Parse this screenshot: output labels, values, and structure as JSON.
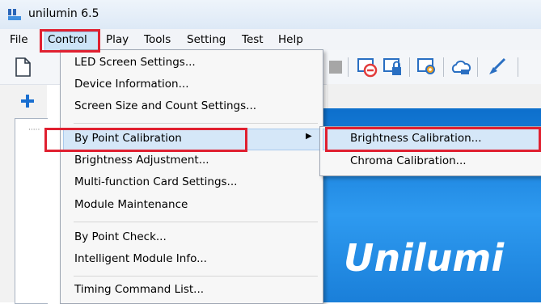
{
  "window": {
    "title": "unilumin 6.5"
  },
  "menubar": {
    "items": [
      "File",
      "Control",
      "Play",
      "Tools",
      "Setting",
      "Test",
      "Help"
    ],
    "active": "Control"
  },
  "control_menu": {
    "items": [
      "LED Screen Settings...",
      "Device Information...",
      "Screen Size and Count Settings...",
      "By Point Calibration",
      "Brightness Adjustment...",
      "Multi-function Card Settings...",
      "Module Maintenance",
      "By Point Check...",
      "Intelligent Module Info...",
      "Timing Command List..."
    ],
    "highlighted": "By Point Calibration"
  },
  "calibration_submenu": {
    "items": [
      "Brightness Calibration...",
      "Chroma Calibration..."
    ],
    "highlighted": "Brightness Calibration..."
  },
  "splash": {
    "text": "Unilumi"
  },
  "colors": {
    "annotation_red": "#e02030",
    "hover_blue": "#d5e7f8",
    "panel_blue": "#1f86e0"
  },
  "icons": [
    "new-document-icon",
    "stop-icon",
    "no-entry-icon",
    "lock-icon",
    "gear-icon",
    "cloud-icon",
    "brush-icon",
    "add-icon"
  ]
}
